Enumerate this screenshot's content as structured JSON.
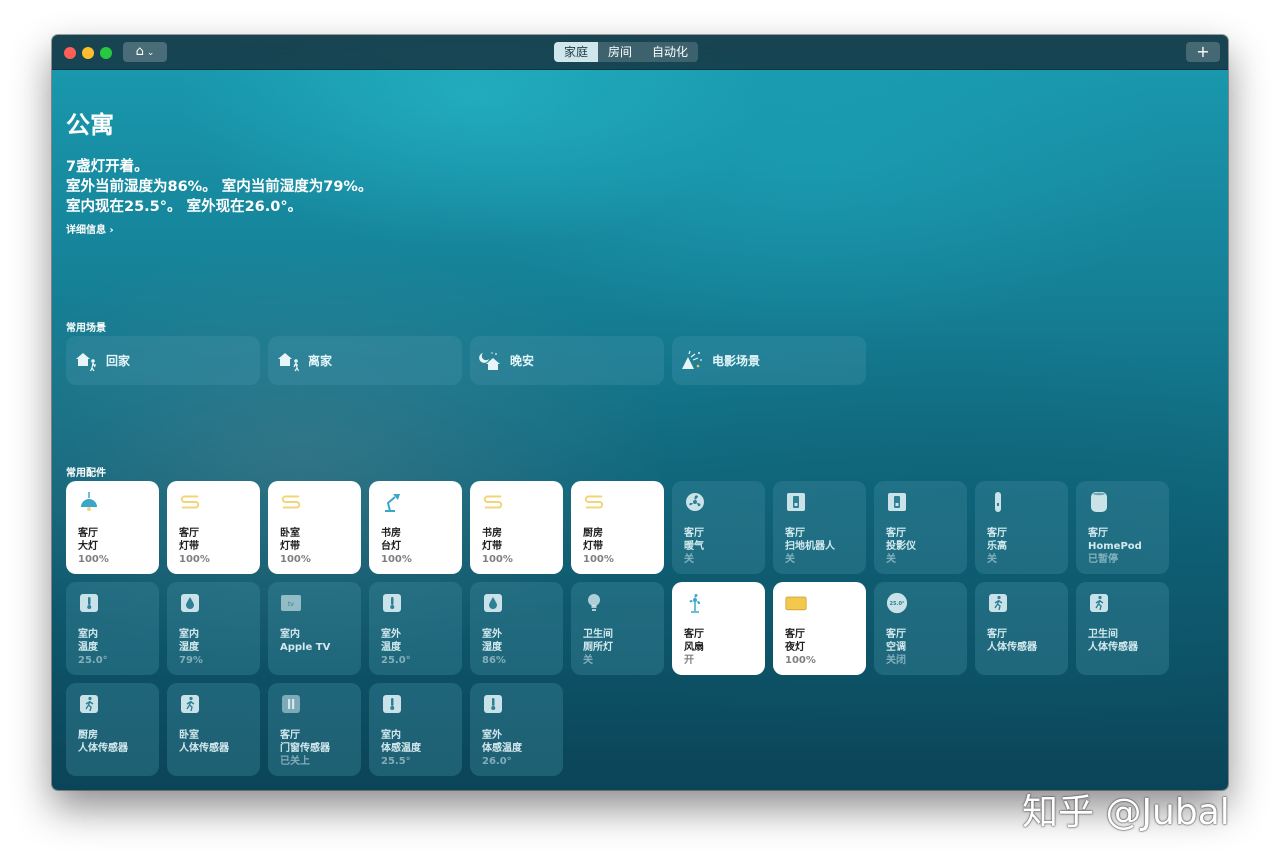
{
  "titlebar": {
    "home_menu_glyph": "⌂",
    "tabs": [
      {
        "label": "家庭",
        "active": true
      },
      {
        "label": "房间",
        "active": false
      },
      {
        "label": "自动化",
        "active": false
      }
    ],
    "add_label": "+"
  },
  "home": {
    "title": "公寓",
    "status_lines": [
      "7盏灯开着。",
      "室外当前湿度为86%。 室内当前湿度为79%。",
      "室内现在25.5°。 室外现在26.0°。"
    ],
    "details_link": "详细信息 ›"
  },
  "scenes_section": {
    "title": "常用场景",
    "items": [
      {
        "label": "回家",
        "icon": "arrive-home-icon"
      },
      {
        "label": "离家",
        "icon": "leave-home-icon"
      },
      {
        "label": "晚安",
        "icon": "good-night-icon"
      },
      {
        "label": "电影场景",
        "icon": "movie-scene-icon"
      }
    ]
  },
  "accessories_section": {
    "title": "常用配件",
    "items": [
      {
        "room": "客厅",
        "name": "大灯",
        "status": "100%",
        "on": true,
        "icon": "pendant-lamp-icon"
      },
      {
        "room": "客厅",
        "name": "灯带",
        "status": "100%",
        "on": true,
        "icon": "light-strip-icon"
      },
      {
        "room": "卧室",
        "name": "灯带",
        "status": "100%",
        "on": true,
        "icon": "light-strip-icon"
      },
      {
        "room": "书房",
        "name": "台灯",
        "status": "100%",
        "on": true,
        "icon": "desk-lamp-icon"
      },
      {
        "room": "书房",
        "name": "灯带",
        "status": "100%",
        "on": true,
        "icon": "light-strip-icon"
      },
      {
        "room": "厨房",
        "name": "灯带",
        "status": "100%",
        "on": true,
        "icon": "light-strip-icon"
      },
      {
        "room": "客厅",
        "name": "暖气",
        "status": "关",
        "on": false,
        "icon": "heater-fan-icon"
      },
      {
        "room": "客厅",
        "name": "扫地机器人",
        "status": "关",
        "on": false,
        "icon": "switch-icon"
      },
      {
        "room": "客厅",
        "name": "投影仪",
        "status": "关",
        "on": false,
        "icon": "switch-icon"
      },
      {
        "room": "客厅",
        "name": "乐高",
        "status": "关",
        "on": false,
        "icon": "plug-icon"
      },
      {
        "room": "客厅",
        "name": "HomePod",
        "status": "已暂停",
        "on": false,
        "icon": "homepod-icon"
      },
      {
        "room": "室内",
        "name": "温度",
        "status": "25.0°",
        "on": false,
        "icon": "thermometer-icon"
      },
      {
        "room": "室内",
        "name": "湿度",
        "status": "79%",
        "on": false,
        "icon": "humidity-icon"
      },
      {
        "room": "室内",
        "name": "Apple TV",
        "status": "",
        "on": false,
        "icon": "apple-tv-icon"
      },
      {
        "room": "室外",
        "name": "温度",
        "status": "25.0°",
        "on": false,
        "icon": "thermometer-icon"
      },
      {
        "room": "室外",
        "name": "湿度",
        "status": "86%",
        "on": false,
        "icon": "humidity-icon"
      },
      {
        "room": "卫生间",
        "name": "厕所灯",
        "status": "关",
        "on": false,
        "icon": "bulb-icon"
      },
      {
        "room": "客厅",
        "name": "风扇",
        "status": "开",
        "on": true,
        "icon": "fan-icon"
      },
      {
        "room": "客厅",
        "name": "夜灯",
        "status": "100%",
        "on": true,
        "icon": "night-light-icon"
      },
      {
        "room": "客厅",
        "name": "空调",
        "status": "关闭",
        "on": false,
        "icon": "thermostat-icon"
      },
      {
        "room": "客厅",
        "name": "人体传感器",
        "status": "",
        "on": false,
        "icon": "motion-sensor-icon"
      },
      {
        "room": "卫生间",
        "name": "人体传感器",
        "status": "",
        "on": false,
        "icon": "motion-sensor-icon"
      },
      {
        "room": "厨房",
        "name": "人体传感器",
        "status": "",
        "on": false,
        "icon": "motion-sensor-icon"
      },
      {
        "room": "卧室",
        "name": "人体传感器",
        "status": "",
        "on": false,
        "icon": "motion-sensor-icon"
      },
      {
        "room": "客厅",
        "name": "门窗传感器",
        "status": "已关上",
        "on": false,
        "icon": "contact-sensor-icon"
      },
      {
        "room": "室内",
        "name": "体感温度",
        "status": "25.5°",
        "on": false,
        "icon": "thermometer-icon"
      },
      {
        "room": "室外",
        "name": "体感温度",
        "status": "26.0°",
        "on": false,
        "icon": "thermometer-icon"
      }
    ]
  },
  "thermostat_badge": "25.0°",
  "apple_tv_badge": "tv",
  "watermark": "知乎 @Jubal",
  "colors": {
    "accent_light": "#3aa7c9",
    "strip_yellow": "#f3d47a",
    "night_light": "#f2c94c",
    "window_top": "#1a9bb0",
    "window_bottom": "#0b4458"
  }
}
